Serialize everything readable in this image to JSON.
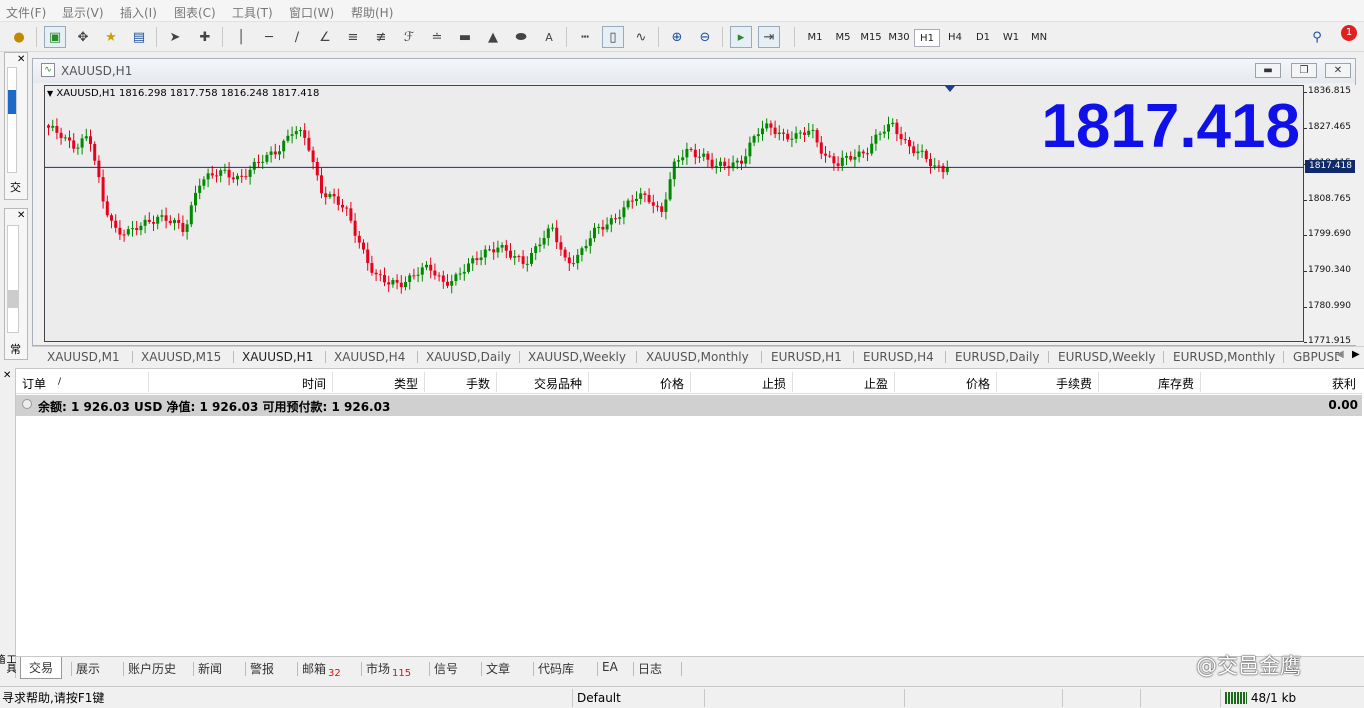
{
  "menu": [
    "文件(F)",
    "显示(V)",
    "插入(I)",
    "图表(C)",
    "工具(T)",
    "窗口(W)",
    "帮助(H)"
  ],
  "timeframes": [
    "M1",
    "M5",
    "M15",
    "M30",
    "H1",
    "H4",
    "D1",
    "W1",
    "MN"
  ],
  "active_timeframe": "H1",
  "notification_count": "1",
  "side_panels": {
    "navigator_caption": "交",
    "market_caption": "常"
  },
  "chart_window": {
    "title": "XAUUSD,H1",
    "symbol_line": "XAUUSD,H1  1816.298 1817.758 1816.248 1817.418",
    "big_price": "1817.418"
  },
  "chart_data": {
    "type": "candlestick",
    "symbol": "XAUUSD",
    "timeframe": "H1",
    "last_bar": {
      "open": 1816.298,
      "high": 1817.758,
      "low": 1816.248,
      "close": 1817.418
    },
    "current_price": 1817.418,
    "ylim": [
      1771.915,
      1838.5
    ],
    "y_ticks": [
      "1836.815",
      "1827.465",
      "1818.115",
      "1808.765",
      "1799.690",
      "1790.340",
      "1780.990",
      "1771.915"
    ],
    "up_color": "#008a00",
    "down_color": "#e8001c",
    "close_anchors": [
      1827,
      1826,
      1823,
      1825,
      1809,
      1801,
      1800,
      1803,
      1805,
      1803,
      1801,
      1814,
      1815,
      1816,
      1815,
      1817,
      1820,
      1823,
      1827,
      1824,
      1812,
      1809,
      1805,
      1797,
      1789,
      1787,
      1788,
      1790,
      1791,
      1788,
      1789,
      1792,
      1796,
      1797,
      1794,
      1793,
      1798,
      1801,
      1793,
      1795,
      1800,
      1803,
      1806,
      1809,
      1810,
      1806,
      1818,
      1822,
      1821,
      1817,
      1818,
      1820,
      1826,
      1828,
      1826,
      1825,
      1827,
      1821,
      1818,
      1820,
      1822,
      1826,
      1828,
      1824,
      1821,
      1817,
      1817.418
    ],
    "axis_label_color": "#111111",
    "price_line_color": "#102a9a"
  },
  "chart_tabs": [
    "XAUUSD,M1",
    "XAUUSD,M15",
    "XAUUSD,H1",
    "XAUUSD,H4",
    "XAUUSD,Daily",
    "XAUUSD,Weekly",
    "XAUUSD,Monthly",
    "EURUSD,H1",
    "EURUSD,H4",
    "EURUSD,Daily",
    "EURUSD,Weekly",
    "EURUSD,Monthly",
    "GBPUSD"
  ],
  "active_chart_tab": "XAUUSD,H1",
  "terminal": {
    "columns": [
      "订单",
      "/",
      "时间",
      "类型",
      "手数",
      "交易品种",
      "价格",
      "止损",
      "止盈",
      "价格",
      "手续费",
      "库存费",
      "获利"
    ],
    "balance_line": "余额: 1 926.03 USD  净值: 1 926.03  可用预付款: 1 926.03",
    "balance_profit": "0.00",
    "side_label": "工具箱",
    "tabs": [
      {
        "label": "交易",
        "badge": ""
      },
      {
        "label": "展示",
        "badge": ""
      },
      {
        "label": "账户历史",
        "badge": ""
      },
      {
        "label": "新闻",
        "badge": ""
      },
      {
        "label": "警报",
        "badge": ""
      },
      {
        "label": "邮箱",
        "badge": "32"
      },
      {
        "label": "市场",
        "badge": "115"
      },
      {
        "label": "信号",
        "badge": ""
      },
      {
        "label": "文章",
        "badge": ""
      },
      {
        "label": "代码库",
        "badge": ""
      },
      {
        "label": "EA",
        "badge": ""
      },
      {
        "label": "日志",
        "badge": ""
      }
    ],
    "active_tab": "交易"
  },
  "statusbar": {
    "help": "寻求帮助,请按F1键",
    "profile": "Default",
    "traffic": "48/1 kb"
  },
  "watermark": "@交邑金鹰"
}
